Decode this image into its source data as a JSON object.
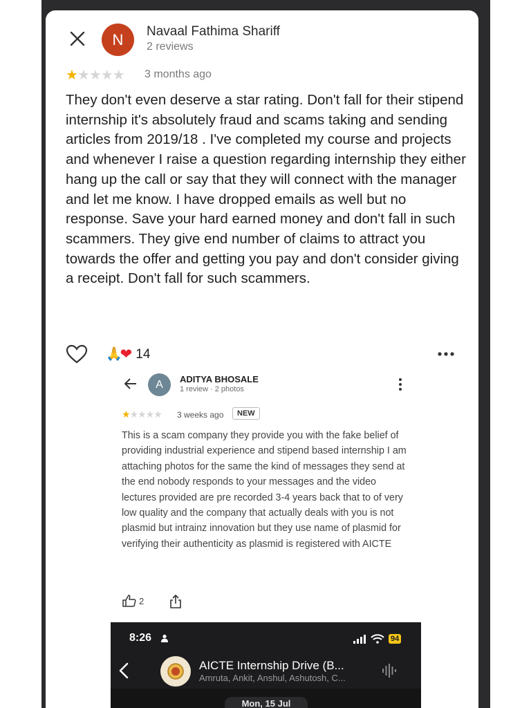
{
  "reviewer": {
    "initial": "N",
    "name": "Navaal Fathima Shariff",
    "review_count": "2 reviews",
    "rating": 1,
    "time": "3 months ago",
    "text": "They don't even deserve a star rating. Don't fall for their stipend internship it's absolutely fraud and scams taking and sending articles from 2019/18 . I've completed my course and projects and whenever I raise a question regarding internship they either hang up the call or say that they will connect with the manager and let me know. I have dropped emails as well but no response. Save your hard earned money and don't fall in such scammers. They give end number of claims to attract you towards the offer and getting you pay and don't consider giving a receipt. Don't fall for such scammers."
  },
  "reactions": {
    "emoji_pray": "🙏",
    "emoji_heart": "❤",
    "count": "14"
  },
  "embedded_review": {
    "initial": "A",
    "name": "ADITYA BHOSALE",
    "meta": "1 review · 2 photos",
    "rating": 1,
    "time": "3 weeks ago",
    "badge": "NEW",
    "text": "This is a scam company they provide you with the fake belief of providing industrial experience and stipend based internship I am attaching photos for the same the kind of messages they send at the end nobody responds to your messages and the video lectures provided are pre recorded 3-4 years back that to of very low quality and the company that actually deals with you is not plasmid but intrainz innovation but they use name of plasmid for verifying their authenticity as plasmid is registered with AICTE",
    "helpful_count": "2"
  },
  "chat": {
    "status_time": "8:26",
    "battery": "94",
    "group_name": "AICTE Internship Drive (B...",
    "members": "Amruta, Ankit, Anshul, Ashutosh, C...",
    "date": "Mon, 15 Jul"
  },
  "colors": {
    "star_on": "#f4b400",
    "star_off": "#d6d6d6",
    "avatar_n": "#c5401d",
    "avatar_a": "#6e8796",
    "battery": "#f5c518"
  },
  "icons": [
    "close-icon",
    "heart-outline-icon",
    "more-horizontal-icon",
    "back-arrow-icon",
    "more-vertical-icon",
    "thumbs-up-icon",
    "share-icon",
    "person-icon",
    "signal-icon",
    "wifi-icon",
    "chevron-left-icon",
    "voice-wave-icon"
  ]
}
